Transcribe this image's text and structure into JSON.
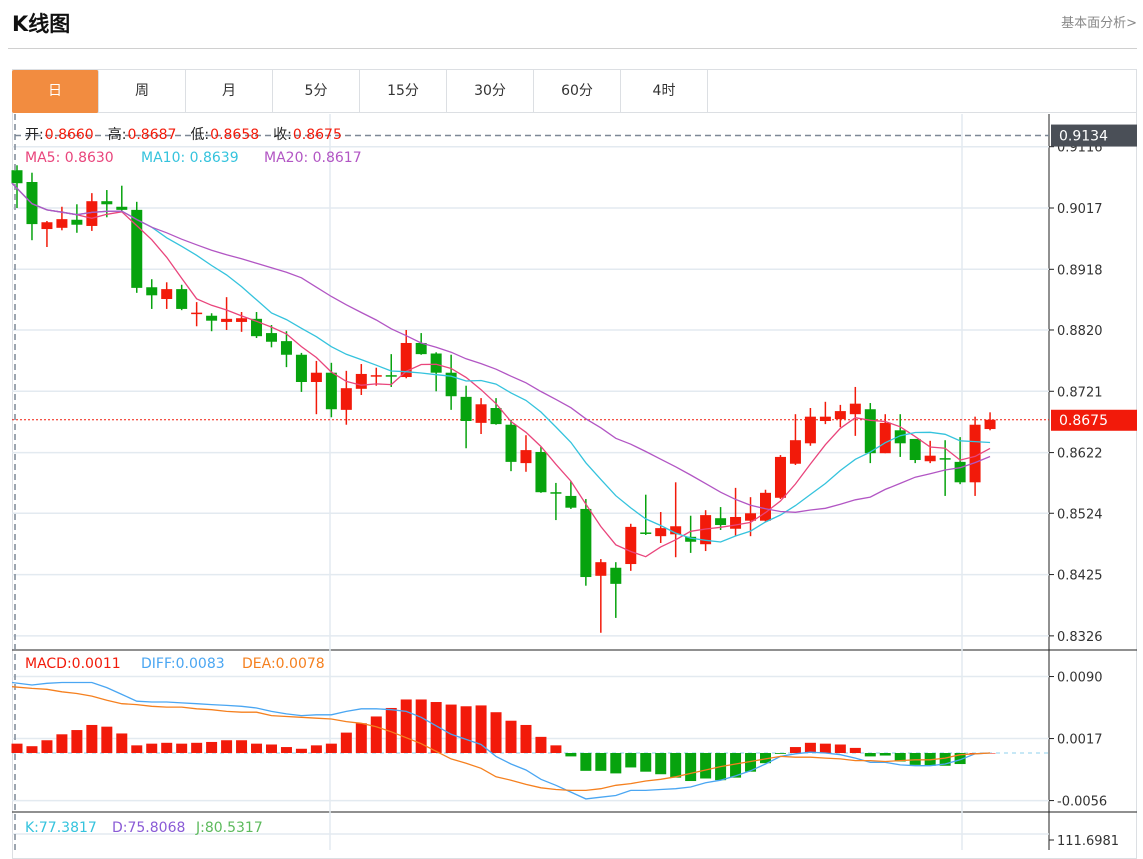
{
  "header": {
    "title": "K线图",
    "link": "基本面分析>"
  },
  "tabs": [
    {
      "label": "日"
    },
    {
      "label": "周"
    },
    {
      "label": "月"
    },
    {
      "label": "5分"
    },
    {
      "label": "15分"
    },
    {
      "label": "30分"
    },
    {
      "label": "60分"
    },
    {
      "label": "4时"
    }
  ],
  "active_tab": 0,
  "legend": {
    "open_label": "开:",
    "open": "0.8660",
    "high_label": "高:",
    "high": "0.8687",
    "low_label": "低:",
    "low": "0.8658",
    "close_label": "收:",
    "close": "0.8675",
    "ma5": "MA5: 0.8630",
    "ma10": "MA10: 0.8639",
    "ma20": "MA20: 0.8617",
    "macd": "MACD:0.0011",
    "diff": "DIFF:0.0083",
    "dea": "DEA:0.0078",
    "k": "K:77.3817",
    "d": "D:75.8068",
    "j": "J:80.5317"
  },
  "colors": {
    "up": "#f21a0a",
    "down": "#07a30e",
    "ma5": "#e9457c",
    "ma10": "#35c3dd",
    "ma20": "#b256c4",
    "diff": "#4aa6f2",
    "dea": "#f5801f",
    "k": "#35c3dd",
    "d": "#8a5bd6",
    "j": "#5cba5c",
    "axis_highlight": "#4a4f57"
  },
  "chart_data": {
    "type": "candlestick",
    "candle_format": [
      "open",
      "high",
      "low",
      "close"
    ],
    "candles": [
      [
        0.9078,
        0.9086,
        0.9017,
        0.9057
      ],
      [
        0.9059,
        0.9074,
        0.8965,
        0.8991
      ],
      [
        0.8983,
        0.8996,
        0.8954,
        0.8994
      ],
      [
        0.8985,
        0.9019,
        0.8981,
        0.8999
      ],
      [
        0.8998,
        0.9023,
        0.8977,
        0.899
      ],
      [
        0.8988,
        0.9041,
        0.898,
        0.9028
      ],
      [
        0.9028,
        0.9046,
        0.9002,
        0.9023
      ],
      [
        0.9019,
        0.9053,
        0.9011,
        0.9014
      ],
      [
        0.9014,
        0.9027,
        0.888,
        0.8888
      ],
      [
        0.8889,
        0.8902,
        0.8854,
        0.8876
      ],
      [
        0.887,
        0.8897,
        0.8854,
        0.8886
      ],
      [
        0.8886,
        0.8893,
        0.8852,
        0.8854
      ],
      [
        0.8846,
        0.8865,
        0.8826,
        0.8848
      ],
      [
        0.8843,
        0.8847,
        0.8818,
        0.8835
      ],
      [
        0.8833,
        0.8873,
        0.882,
        0.8838
      ],
      [
        0.8833,
        0.8849,
        0.8817,
        0.8839
      ],
      [
        0.8838,
        0.8849,
        0.8807,
        0.881
      ],
      [
        0.8815,
        0.8828,
        0.8792,
        0.8801
      ],
      [
        0.8802,
        0.8818,
        0.876,
        0.878
      ],
      [
        0.878,
        0.8783,
        0.872,
        0.8736
      ],
      [
        0.8736,
        0.877,
        0.8684,
        0.8751
      ],
      [
        0.8751,
        0.8767,
        0.8679,
        0.8692
      ],
      [
        0.8691,
        0.8754,
        0.8667,
        0.8726
      ],
      [
        0.8725,
        0.8765,
        0.8715,
        0.8749
      ],
      [
        0.8745,
        0.8759,
        0.873,
        0.8747
      ],
      [
        0.8747,
        0.8781,
        0.8728,
        0.8745
      ],
      [
        0.8744,
        0.882,
        0.8742,
        0.8799
      ],
      [
        0.8799,
        0.8815,
        0.878,
        0.8781
      ],
      [
        0.8782,
        0.8784,
        0.8721,
        0.8751
      ],
      [
        0.8751,
        0.878,
        0.8691,
        0.8713
      ],
      [
        0.8712,
        0.873,
        0.8629,
        0.8673
      ],
      [
        0.867,
        0.871,
        0.8652,
        0.87
      ],
      [
        0.8694,
        0.871,
        0.8667,
        0.8668
      ],
      [
        0.8667,
        0.8675,
        0.8592,
        0.8607
      ],
      [
        0.8605,
        0.865,
        0.8591,
        0.8626
      ],
      [
        0.8623,
        0.8631,
        0.8557,
        0.8558
      ],
      [
        0.8558,
        0.8573,
        0.8513,
        0.8556
      ],
      [
        0.8552,
        0.8576,
        0.8531,
        0.8533
      ],
      [
        0.8531,
        0.8547,
        0.8407,
        0.8421
      ],
      [
        0.8423,
        0.845,
        0.8331,
        0.8445
      ],
      [
        0.8436,
        0.8445,
        0.8355,
        0.841
      ],
      [
        0.8442,
        0.8507,
        0.8431,
        0.8502
      ],
      [
        0.8493,
        0.8554,
        0.8489,
        0.8491
      ],
      [
        0.8487,
        0.8526,
        0.8476,
        0.85
      ],
      [
        0.849,
        0.8574,
        0.8453,
        0.8503
      ],
      [
        0.8486,
        0.852,
        0.846,
        0.8478
      ],
      [
        0.8474,
        0.8529,
        0.8463,
        0.8521
      ],
      [
        0.8516,
        0.8534,
        0.8497,
        0.8505
      ],
      [
        0.8499,
        0.8565,
        0.8487,
        0.8518
      ],
      [
        0.8512,
        0.855,
        0.8487,
        0.8524
      ],
      [
        0.8512,
        0.8562,
        0.851,
        0.8557
      ],
      [
        0.8549,
        0.8618,
        0.8547,
        0.8615
      ],
      [
        0.8604,
        0.8684,
        0.8602,
        0.8642
      ],
      [
        0.8637,
        0.8694,
        0.8633,
        0.868
      ],
      [
        0.8673,
        0.8704,
        0.8668,
        0.868
      ],
      [
        0.8676,
        0.8699,
        0.8663,
        0.8689
      ],
      [
        0.8684,
        0.8728,
        0.8649,
        0.8701
      ],
      [
        0.8692,
        0.8702,
        0.8605,
        0.8621
      ],
      [
        0.8621,
        0.8684,
        0.8621,
        0.867
      ],
      [
        0.8658,
        0.8684,
        0.8615,
        0.8637
      ],
      [
        0.8644,
        0.8644,
        0.8605,
        0.861
      ],
      [
        0.8608,
        0.8641,
        0.8605,
        0.8617
      ],
      [
        0.8613,
        0.8642,
        0.8552,
        0.8611
      ],
      [
        0.8607,
        0.8647,
        0.8571,
        0.8574
      ],
      [
        0.8574,
        0.868,
        0.8552,
        0.8667
      ],
      [
        0.866,
        0.8687,
        0.8658,
        0.8675
      ]
    ],
    "price_ticks": [
      "0.9116",
      "0.9017",
      "0.8918",
      "0.8820",
      "0.8721",
      "0.8622",
      "0.8524",
      "0.8425",
      "0.8326"
    ],
    "price_highlight": {
      "high": "0.9134",
      "last": "0.8675"
    },
    "macd": [
      0.0011,
      0.0008,
      0.0015,
      0.0022,
      0.0027,
      0.0033,
      0.0031,
      0.0023,
      0.0009,
      0.0011,
      0.0012,
      0.0011,
      0.0012,
      0.0013,
      0.0015,
      0.0015,
      0.0011,
      0.001,
      0.0007,
      0.0005,
      0.0009,
      0.0011,
      0.0024,
      0.0035,
      0.0043,
      0.0053,
      0.0063,
      0.0063,
      0.006,
      0.0057,
      0.0055,
      0.0056,
      0.0048,
      0.0038,
      0.0033,
      0.0019,
      0.0009,
      -0.0004,
      -0.0021,
      -0.0021,
      -0.0024,
      -0.0017,
      -0.0022,
      -0.0025,
      -0.0029,
      -0.0033,
      -0.003,
      -0.0032,
      -0.0029,
      -0.0022,
      -0.0012,
      -0.0001,
      0.0007,
      0.0012,
      0.0011,
      0.001,
      0.0006,
      -0.0004,
      -0.0003,
      -0.001,
      -0.0014,
      -0.0015,
      -0.0015,
      -0.0013,
      0.0,
      0.0
    ],
    "diff": [
      0.0083,
      0.008,
      0.0082,
      0.0083,
      0.0083,
      0.0083,
      0.0077,
      0.0069,
      0.0061,
      0.006,
      0.006,
      0.0059,
      0.0058,
      0.0057,
      0.0056,
      0.0055,
      0.0053,
      0.0049,
      0.0046,
      0.0044,
      0.0045,
      0.0045,
      0.0049,
      0.0052,
      0.0052,
      0.0051,
      0.0049,
      0.0042,
      0.0032,
      0.0022,
      0.0016,
      0.001,
      -0.0004,
      -0.0013,
      -0.002,
      -0.0031,
      -0.0038,
      -0.0046,
      -0.0054,
      -0.0052,
      -0.005,
      -0.0044,
      -0.0044,
      -0.0043,
      -0.0042,
      -0.004,
      -0.0035,
      -0.0032,
      -0.0027,
      -0.0021,
      -0.0013,
      -0.0004,
      -0.0001,
      0.0001,
      0.0,
      -0.0002,
      -0.0006,
      -0.0011,
      -0.0011,
      -0.0014,
      -0.0015,
      -0.0015,
      -0.0013,
      -0.0008,
      -0.0001,
      0.0
    ],
    "dea": [
      0.0078,
      0.0076,
      0.0075,
      0.0072,
      0.007,
      0.0067,
      0.0062,
      0.0058,
      0.0057,
      0.0055,
      0.0054,
      0.0054,
      0.0052,
      0.0051,
      0.0049,
      0.0048,
      0.0048,
      0.0044,
      0.0043,
      0.0042,
      0.0041,
      0.004,
      0.0037,
      0.0035,
      0.0031,
      0.0025,
      0.0018,
      0.0011,
      0.0002,
      -0.0007,
      -0.0012,
      -0.0018,
      -0.0028,
      -0.0032,
      -0.0037,
      -0.0041,
      -0.0043,
      -0.0044,
      -0.0044,
      -0.0042,
      -0.0038,
      -0.0036,
      -0.0033,
      -0.0031,
      -0.0028,
      -0.0024,
      -0.002,
      -0.0016,
      -0.0013,
      -0.001,
      -0.0007,
      -0.0004,
      -0.0005,
      -0.0005,
      -0.0006,
      -0.0007,
      -0.0009,
      -0.0009,
      -0.001,
      -0.0009,
      -0.0008,
      -0.0008,
      -0.0006,
      -0.0002,
      -0.0001,
      0.0
    ],
    "macd_ticks": [
      "0.0090",
      "0.0017",
      "-0.0056"
    ],
    "kdj_ticks": [
      "111.6981"
    ],
    "ma_periods": [
      5,
      10,
      20
    ]
  }
}
